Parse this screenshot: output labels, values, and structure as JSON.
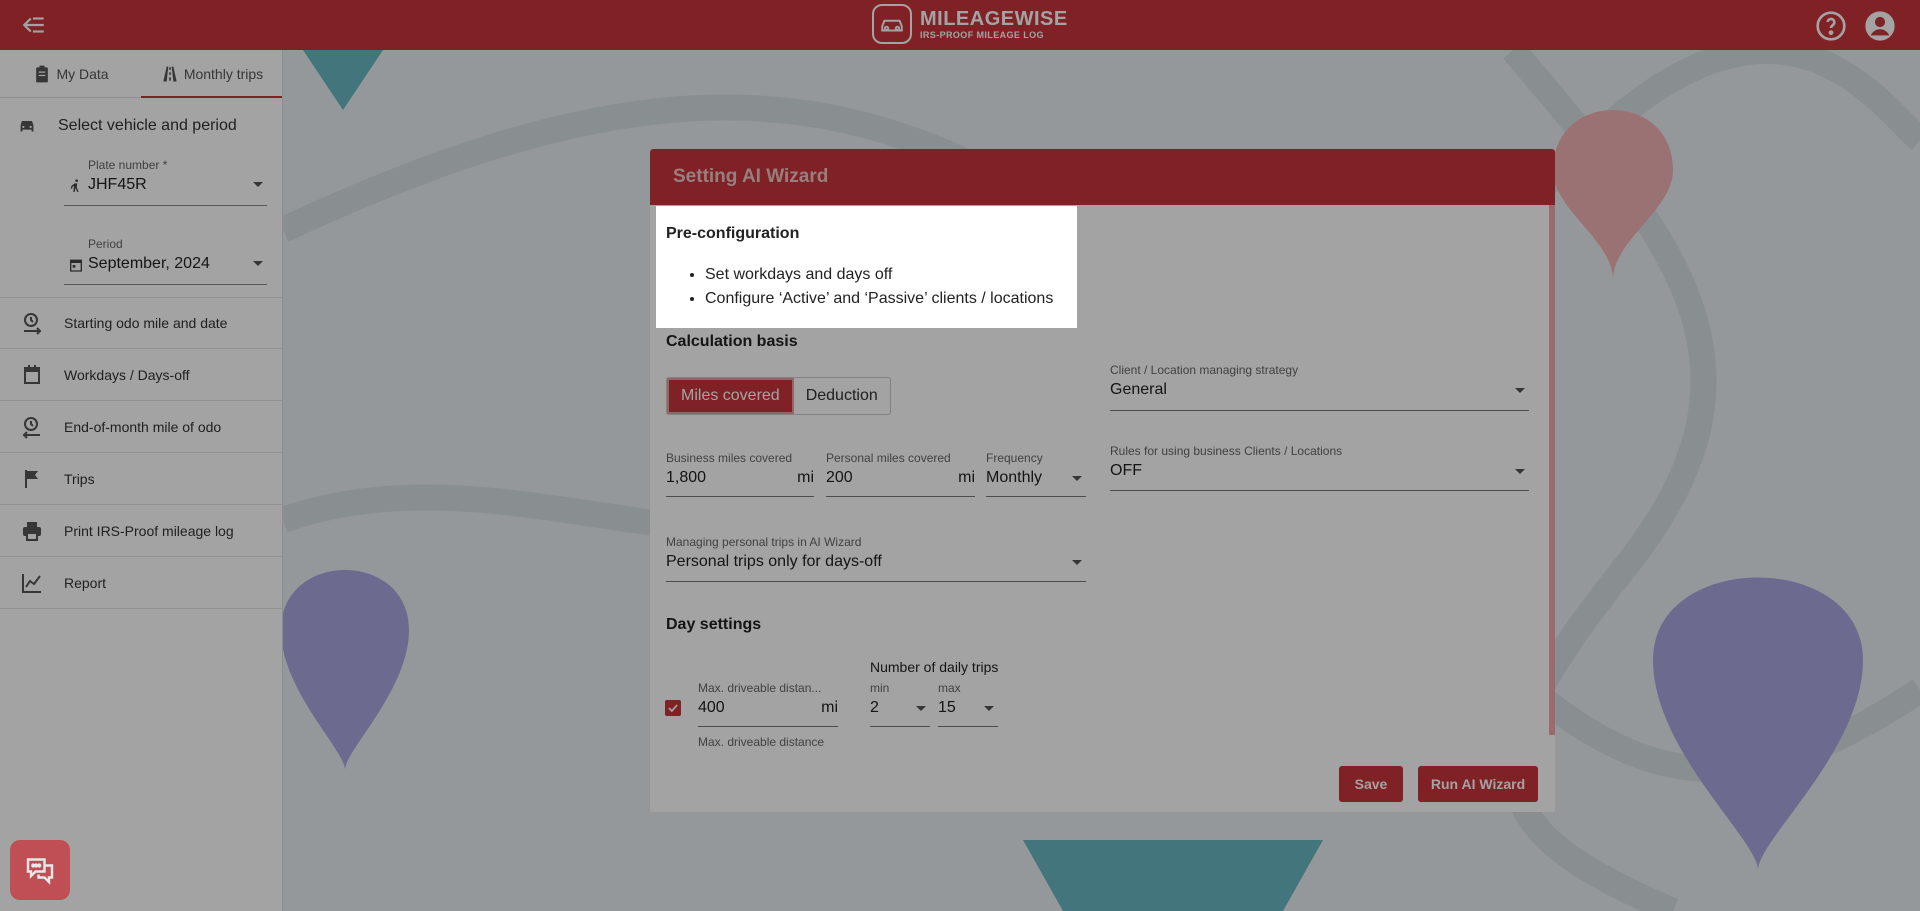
{
  "header": {
    "logo_title": "MILEAGEWISE",
    "logo_subtitle": "IRS-PROOF MILEAGE LOG",
    "brand_color": "#c9343a"
  },
  "sidebar": {
    "tabs": [
      {
        "label": "My Data",
        "icon": "clipboard-icon"
      },
      {
        "label": "Monthly trips",
        "icon": "road-icon"
      }
    ],
    "heading": "Select vehicle and period",
    "plate_label": "Plate number *",
    "plate_value": "JHF45R",
    "period_label": "Period",
    "period_value": "September, 2024",
    "items": [
      {
        "label": "Starting odo mile and date",
        "icon": "odo-start-icon"
      },
      {
        "label": "Workdays / Days-off",
        "icon": "calendar-icon"
      },
      {
        "label": "End-of-month mile of odo",
        "icon": "odo-end-icon"
      },
      {
        "label": "Trips",
        "icon": "flag-icon"
      },
      {
        "label": "Print IRS-Proof mileage log",
        "icon": "print-icon"
      },
      {
        "label": "Report",
        "icon": "chart-line-icon"
      }
    ]
  },
  "dialog": {
    "title": "Setting AI Wizard",
    "preconfig_title": "Pre-configuration",
    "preconfig_items": [
      "Set workdays and days off",
      "Configure ‘Active’ and ‘Passive’ clients / locations"
    ],
    "calc_title": "Calculation basis",
    "toggle_miles": "Miles covered",
    "toggle_deduction": "Deduction",
    "strategy_label": "Client / Location managing strategy",
    "strategy_value": "General",
    "business_label": "Business miles covered",
    "business_value": "1,800",
    "personal_label": "Personal miles covered",
    "personal_value": "200",
    "unit": "mi",
    "frequency_label": "Frequency",
    "frequency_value": "Monthly",
    "rules_label": "Rules for using business Clients / Locations",
    "rules_value": "OFF",
    "personal_trips_label": "Managing personal trips in AI Wizard",
    "personal_trips_value": "Personal trips only for days-off",
    "day_title": "Day settings",
    "max_dist_label": "Max. driveable distan...",
    "max_dist_value": "400",
    "max_dist_helper": "Max. driveable distance",
    "daily_trips_label": "Number of daily trips",
    "min_label": "min",
    "min_value": "2",
    "max_label": "max",
    "max_value": "15",
    "save_label": "Save",
    "run_label": "Run AI Wizard"
  }
}
